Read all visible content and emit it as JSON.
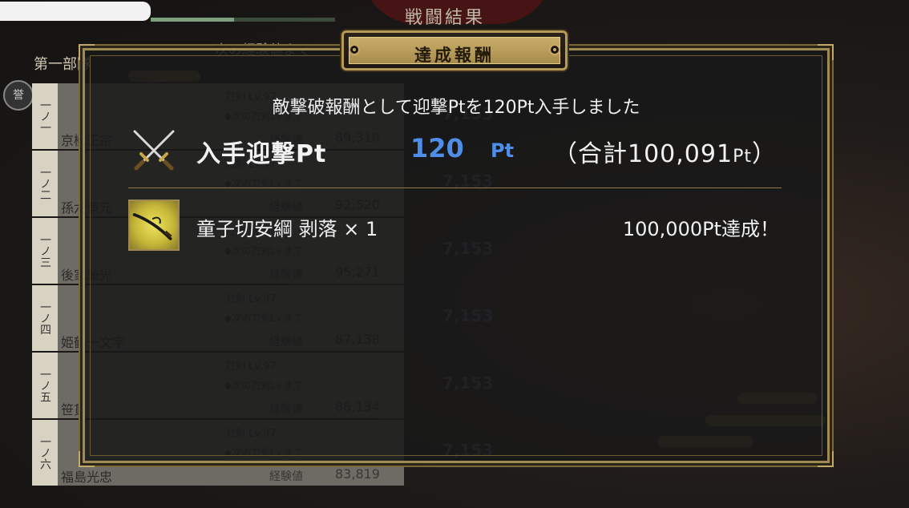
{
  "background": {
    "screen_title": "戦闘結果",
    "subtitle": "次の経験値まで",
    "team_name": "第一部隊",
    "rank_badge": "誉",
    "rows": [
      {
        "slot": "一ノ一",
        "name": "京極正宗",
        "level": "刀剣 Lv.97",
        "next": "◆次の刀剣Lv.まで",
        "xp_label": "経験値",
        "xp_value": "89,310",
        "gain": "7,153"
      },
      {
        "slot": "一ノ二",
        "name": "孫六兼元",
        "level": "刀剣 Lv.97",
        "next": "◆次の刀剣Lv.まで",
        "xp_label": "経験値",
        "xp_value": "92,520",
        "gain": "7,153"
      },
      {
        "slot": "一ノ三",
        "name": "後家兼光",
        "level": "刀剣 Lv.97",
        "next": "◆次の刀剣Lv.まで",
        "xp_label": "経験値",
        "xp_value": "95,271",
        "gain": "7,153"
      },
      {
        "slot": "一ノ四",
        "name": "姫鶴一文字",
        "level": "刀剣 Lv.97",
        "next": "◆次の刀剣Lv.まで",
        "xp_label": "経験値",
        "xp_value": "87,138",
        "gain": "7,153"
      },
      {
        "slot": "一ノ五",
        "name": "笹貫",
        "level": "刀剣 Lv.97",
        "next": "◆次の刀剣Lv.まで",
        "xp_label": "経験値",
        "xp_value": "86,134",
        "gain": "7,153"
      },
      {
        "slot": "一ノ六",
        "name": "福島光忠",
        "level": "刀剣 Lv.97",
        "next": "◆次の刀剣Lv.まで",
        "xp_label": "経験値",
        "xp_value": "83,819",
        "gain": "7,153"
      }
    ]
  },
  "modal": {
    "title": "達成報酬",
    "message": "敵撃破報酬として迎撃Ptを120Pt入手しました",
    "points": {
      "icon": "crossed-swords-icon",
      "label": "入手迎撃Pt",
      "value": "120",
      "unit": "Pt",
      "total_prefix": "（合計100,091",
      "total_unit": "Pt",
      "total_suffix": "）"
    },
    "reward": {
      "icon": "sword-item-icon",
      "label": "童子切安綱 剥落 × 1",
      "status": "100,000Pt達成！"
    }
  },
  "colors": {
    "accent_gold": "#b89a58",
    "points_blue": "#4f8ee8",
    "panel_bg": "#191918"
  }
}
